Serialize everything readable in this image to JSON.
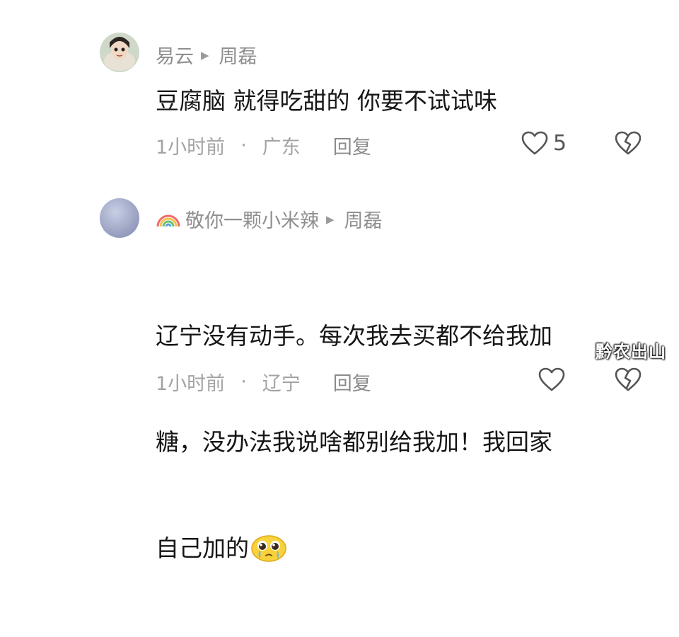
{
  "comments": [
    {
      "author": "易云",
      "reply_to": "周磊",
      "body": "豆腐脑 就得吃甜的 你要不试试味",
      "time": "1小时前",
      "location": "广东",
      "reply_label": "回复",
      "likes": "5"
    },
    {
      "author": "敬你一颗小米辣",
      "reply_to": "周磊",
      "body_lines": [
        "辽宁没有动手。每次我去买都不给我加",
        "糖，没办法我说啥都别给我加！我回家",
        "自己加的"
      ],
      "time": "1小时前",
      "location": "辽宁",
      "reply_label": "回复"
    }
  ],
  "separator": "·",
  "watermark": "黔农出山",
  "icons": {
    "reply_arrow": "play-triangle-icon",
    "like": "heart-outline-icon",
    "dislike": "broken-heart-icon",
    "emoji": "pleading-face-emoji-icon",
    "badge": "rainbow-icon"
  }
}
